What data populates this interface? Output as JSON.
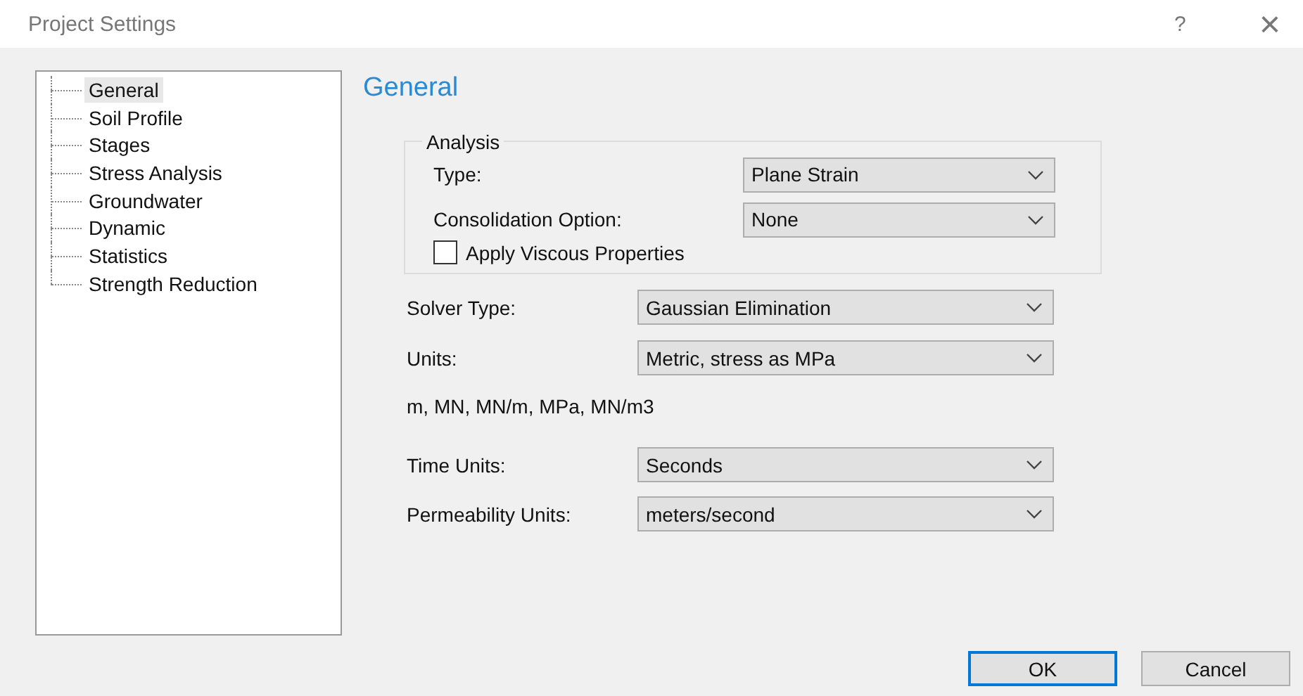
{
  "window": {
    "title": "Project Settings",
    "help": "?",
    "close": "×"
  },
  "tree": {
    "items": [
      {
        "label": "General",
        "selected": true
      },
      {
        "label": "Soil Profile",
        "selected": false
      },
      {
        "label": "Stages",
        "selected": false
      },
      {
        "label": "Stress Analysis",
        "selected": false
      },
      {
        "label": "Groundwater",
        "selected": false
      },
      {
        "label": "Dynamic",
        "selected": false
      },
      {
        "label": "Statistics",
        "selected": false
      },
      {
        "label": "Strength Reduction",
        "selected": false
      }
    ]
  },
  "heading": "General",
  "analysis": {
    "legend": "Analysis",
    "fields": [
      {
        "label": "Type:",
        "value": "Plane Strain"
      },
      {
        "label": "Consolidation Option:",
        "value": "None"
      }
    ],
    "checkbox": {
      "label": "Apply Viscous Properties",
      "checked": false
    }
  },
  "solver": {
    "label": "Solver Type:",
    "value": "Gaussian Elimination"
  },
  "units": {
    "label": "Units:",
    "value": "Metric, stress as MPa"
  },
  "units_note": "m, MN, MN/m, MPa, MN/m3",
  "more_fields": [
    {
      "label": "Time Units:",
      "value": "Seconds"
    },
    {
      "label": "Permeability Units:",
      "value": "meters/second"
    }
  ],
  "buttons": [
    {
      "label": "OK",
      "default": true
    },
    {
      "label": "Cancel",
      "default": false
    }
  ]
}
